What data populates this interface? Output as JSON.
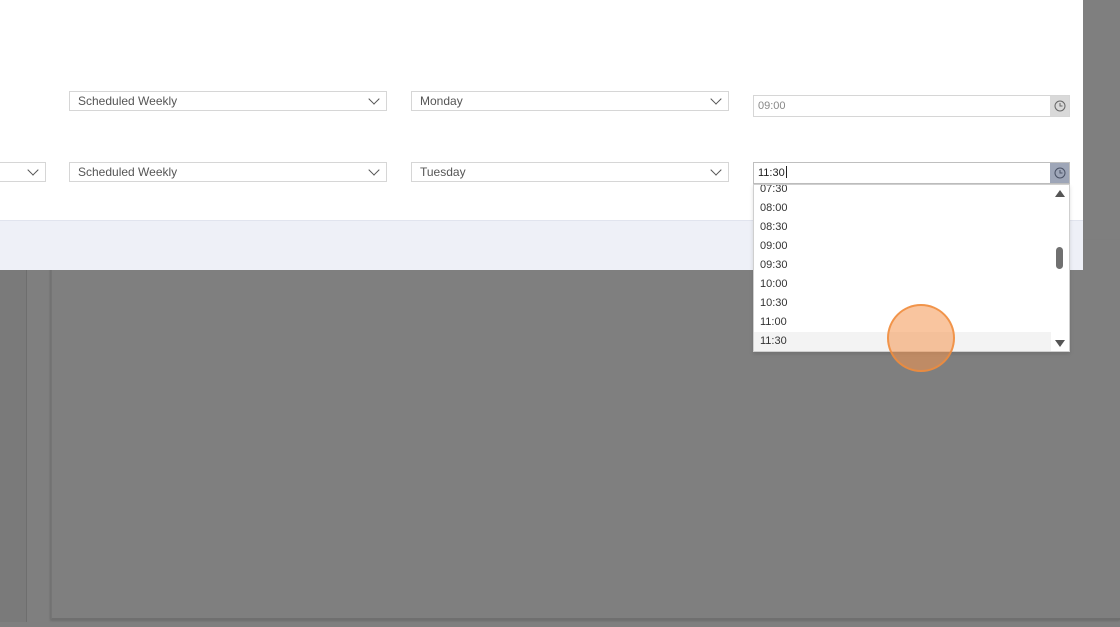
{
  "row1": {
    "schedule_value": "Scheduled Weekly",
    "day_value": "Monday",
    "time_value": "09:00"
  },
  "row2": {
    "schedule_value": "Scheduled Weekly",
    "day_value": "Tuesday",
    "time_value": "11:30"
  },
  "time_dropdown": {
    "options": [
      "07:30",
      "08:00",
      "08:30",
      "09:00",
      "09:30",
      "10:00",
      "10:30",
      "11:00",
      "11:30"
    ]
  },
  "icons": {
    "clock": "clock-icon",
    "chevron": "chevron-down-icon",
    "scroll_up": "triangle-up-icon",
    "scroll_down": "triangle-down-icon"
  },
  "colors": {
    "overlay": "#7f7f7f",
    "footer": "#eef0f7",
    "cursor_highlight": "#f4a060"
  }
}
